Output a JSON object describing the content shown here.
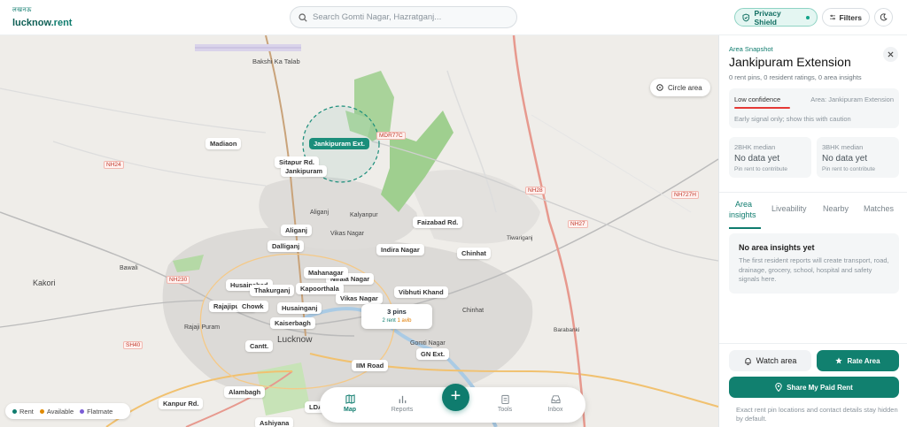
{
  "brand": {
    "hindi": "लखनऊ",
    "name": "lucknow",
    "tld": ".rent"
  },
  "search": {
    "placeholder": "Search Gomti Nagar, Hazratganj..."
  },
  "header": {
    "privacy_label": "Privacy Shield",
    "filters_label": "Filters"
  },
  "map": {
    "circle_area_label": "Circle area",
    "selected_area": "Jankipuram Ext.",
    "locality_labels": [
      "Madiaon",
      "Sitapur Rd.",
      "Jankipuram",
      "Aliganj",
      "Dalliganj",
      "Faizabad Rd.",
      "Indira Nagar",
      "Chinhat",
      "Nirala Nagar",
      "Mahanagar",
      "Kapoorthala",
      "Vikas Nagar",
      "Vibhuti Khand",
      "Husainabad",
      "Thakurganj",
      "Rajajipuram",
      "Chowk",
      "Husainganj",
      "Kaiserbagh",
      "Cantt.",
      "Alambagh",
      "Kanpur Rd.",
      "IIM Road",
      "GN Ext.",
      "LDA",
      "Ashiyana"
    ],
    "place_names": [
      "Bakshi Ka Talab",
      "Kakori",
      "Bawali",
      "Rajaji Puram",
      "Lucknow",
      "Aliganj",
      "Kalyanpur",
      "Vikas Nagar",
      "Gomti Nagar",
      "Chinhat",
      "Tiwariganj",
      "Barabanki"
    ],
    "road_shields": [
      "NH24",
      "NH230",
      "SH40",
      "NH28",
      "NH27",
      "NH727H",
      "MDR77C"
    ],
    "pin_cluster": {
      "count_label": "3 pins",
      "rent_label": "2 rent",
      "avail_label": "1 avib"
    },
    "legend": [
      {
        "label": "Rent",
        "color": "#0f7c6e"
      },
      {
        "label": "Available",
        "color": "#e08a00"
      },
      {
        "label": "Flatmate",
        "color": "#7b5cd6"
      }
    ]
  },
  "bottom_nav": {
    "items": [
      {
        "label": "Map",
        "icon": "map-icon",
        "active": true
      },
      {
        "label": "Reports",
        "icon": "chart-icon"
      },
      {
        "label": "Tools",
        "icon": "clipboard-icon"
      },
      {
        "label": "Inbox",
        "icon": "inbox-icon"
      }
    ],
    "fab_label": "+"
  },
  "panel": {
    "eyebrow": "Area Snapshot",
    "title": "Jankipuram Extension",
    "meta": "0 rent pins, 0 resident ratings, 0 area insights",
    "confidence": {
      "level": "Low confidence",
      "area": "Area: Jankipuram Extension",
      "note": "Early signal only; show this with caution",
      "color": "#e53935"
    },
    "cards": [
      {
        "heading": "2BHK median",
        "value": "No data yet",
        "footnote": "Pin rent to contribute"
      },
      {
        "heading": "3BHK median",
        "value": "No data yet",
        "footnote": "Pin rent to contribute"
      }
    ],
    "tabs": {
      "area_line1": "Area",
      "area_line2": "insights",
      "liveability": "Liveability",
      "nearby": "Nearby",
      "matches": "Matches"
    },
    "empty": {
      "title": "No area insights yet",
      "body": "The first resident reports will create transport, road, drainage, grocery, school, hospital and safety signals here."
    },
    "watch_label": "Watch area",
    "rate_label": "Rate Area",
    "share_label": "Share My Paid Rent",
    "footnote": "Exact rent pin locations and contact details stay hidden by default."
  }
}
